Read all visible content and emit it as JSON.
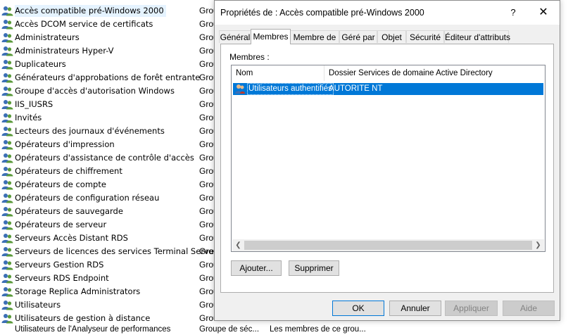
{
  "background_list": {
    "rows": [
      {
        "name": "Accès compatible pré-Windows 2000",
        "type": "Grou",
        "selected": true
      },
      {
        "name": "Accès DCOM service de certificats",
        "type": "Grou"
      },
      {
        "name": "Administrateurs",
        "type": "Grou"
      },
      {
        "name": "Administrateurs Hyper-V",
        "type": "Grou"
      },
      {
        "name": "Duplicateurs",
        "type": "Grou"
      },
      {
        "name": "Générateurs d'approbations de forêt entrante",
        "type": "Grou"
      },
      {
        "name": "Groupe d'accès d'autorisation Windows",
        "type": "Grou"
      },
      {
        "name": "IIS_IUSRS",
        "type": "Grou"
      },
      {
        "name": "Invités",
        "type": "Grou"
      },
      {
        "name": "Lecteurs des journaux d'événements",
        "type": "Grou"
      },
      {
        "name": "Opérateurs d'impression",
        "type": "Grou"
      },
      {
        "name": "Opérateurs d'assistance de contrôle d'accès",
        "type": "Grou"
      },
      {
        "name": "Opérateurs de chiffrement",
        "type": "Grou"
      },
      {
        "name": "Opérateurs de compte",
        "type": "Grou"
      },
      {
        "name": "Opérateurs de configuration réseau",
        "type": "Grou"
      },
      {
        "name": "Opérateurs de sauvegarde",
        "type": "Grou"
      },
      {
        "name": "Opérateurs de serveur",
        "type": "Grou"
      },
      {
        "name": "Serveurs Accès Distant RDS",
        "type": "Grou"
      },
      {
        "name": "Serveurs de licences des services Terminal Server",
        "type": "Grou"
      },
      {
        "name": "Serveurs Gestion RDS",
        "type": "Grou"
      },
      {
        "name": "Serveurs RDS Endpoint",
        "type": "Grou"
      },
      {
        "name": "Storage Replica Administrators",
        "type": "Grou"
      },
      {
        "name": "Utilisateurs",
        "type": "Grou"
      },
      {
        "name": "Utilisateurs de gestion à distance",
        "type": "Grou"
      }
    ],
    "last_row": {
      "name": "Utilisateurs de l'Analyseur de performances",
      "type": "Groupe de séc...",
      "description": "Les membres de ce grou..."
    }
  },
  "dialog": {
    "title": "Propriétés de : Accès compatible pré-Windows 2000",
    "help_label": "?",
    "close_label": "✕",
    "tabs": [
      {
        "label": "Général"
      },
      {
        "label": "Membres",
        "active": true
      },
      {
        "label": "Membre de"
      },
      {
        "label": "Géré par"
      },
      {
        "label": "Objet"
      },
      {
        "label": "Sécurité"
      },
      {
        "label": "Éditeur d'attributs"
      }
    ],
    "members_label": "Membres :",
    "columns": [
      "Nom",
      "Dossier Services de domaine Active Directory"
    ],
    "members": [
      {
        "name": "Utilisateurs authentifiés",
        "folder": "AUTORITE NT"
      }
    ],
    "add_button": "Ajouter...",
    "remove_button": "Supprimer",
    "ok_button": "OK",
    "cancel_button": "Annuler",
    "apply_button": "Appliquer",
    "help_button": "Aide"
  },
  "colors": {
    "selection": "#0078d7",
    "dialog_bg": "#f0f0f0",
    "icon_blue": "#3c6fb5",
    "icon_green": "#5a9a3a"
  }
}
